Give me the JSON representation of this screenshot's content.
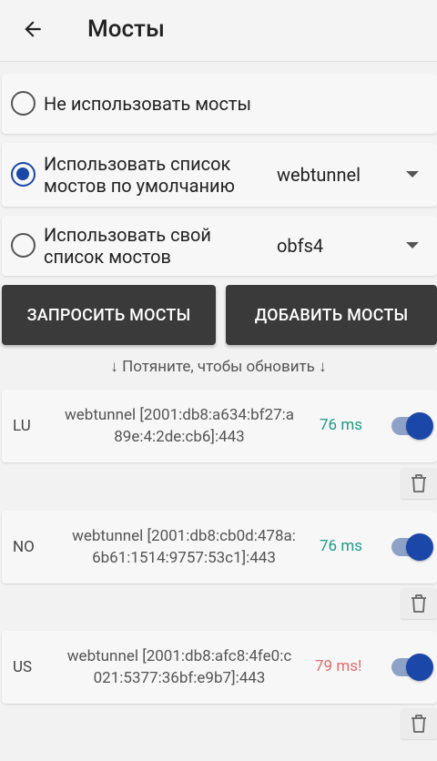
{
  "header": {
    "title": "Мосты",
    "back_icon": "arrow-left-icon"
  },
  "options": [
    {
      "label": "Не использовать мосты",
      "selected": false
    },
    {
      "label_line1": "Использовать список",
      "label_line2": "мостов по умолчанию",
      "selected": true,
      "select_value": "webtunnel"
    },
    {
      "label_line1": "Использовать свой",
      "label_line2": "список мостов",
      "selected": false,
      "select_value": "obfs4"
    }
  ],
  "buttons": {
    "request": "ЗАПРОСИТЬ МОСТЫ",
    "add": "ДОБАВИТЬ МОСТЫ"
  },
  "hint": "↓ Потяните, чтобы обновить ↓",
  "bridges": [
    {
      "country": "LU",
      "line1": "webtunnel [2001:db8:a634:bf27:a",
      "line2": "89e:4:2de:cb6]:443",
      "ping": "76 ms",
      "ping_color": "#1f9a8a",
      "enabled": true
    },
    {
      "country": "NO",
      "line1": "webtunnel [2001:db8:cb0d:478a:",
      "line2": "6b61:1514:9757:53c1]:443",
      "ping": "76 ms",
      "ping_color": "#1f9a8a",
      "enabled": true
    },
    {
      "country": "US",
      "line1": "webtunnel [2001:db8:afc8:4fe0:c",
      "line2": "021:5377:36bf:e9b7]:443",
      "ping": "79 ms!",
      "ping_color": "#e06b6b",
      "enabled": true
    }
  ],
  "colors": {
    "accent": "#1a47a8",
    "button_bg": "#3a3a3a",
    "ping_good": "#1f9a8a",
    "ping_warn": "#e06b6b"
  }
}
